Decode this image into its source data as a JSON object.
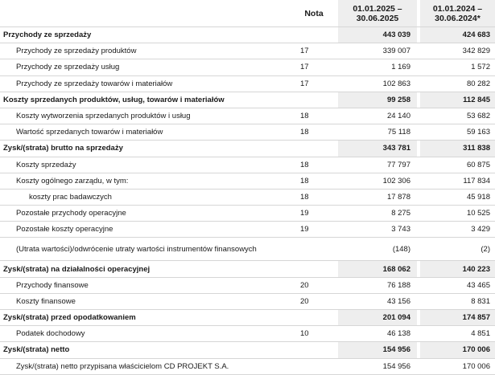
{
  "header": {
    "nota": "Nota",
    "period1_line1": "01.01.2025 –",
    "period1_line2": "30.06.2025",
    "period2_line1": "01.01.2024 –",
    "period2_line2": "30.06.2024*"
  },
  "rows": [
    {
      "label": "Przychody ze sprzedaży",
      "nota": "",
      "v1": "443 039",
      "v2": "424 683",
      "type": "total"
    },
    {
      "label": "Przychody ze sprzedaży produktów",
      "nota": "17",
      "v1": "339 007",
      "v2": "342 829",
      "type": "item"
    },
    {
      "label": "Przychody ze sprzedaży usług",
      "nota": "17",
      "v1": "1 169",
      "v2": "1 572",
      "type": "item"
    },
    {
      "label": "Przychody ze sprzedaży towarów i materiałów",
      "nota": "17",
      "v1": "102 863",
      "v2": "80 282",
      "type": "item"
    },
    {
      "label": "Koszty sprzedanych produktów, usług, towarów i materiałów",
      "nota": "",
      "v1": "99 258",
      "v2": "112 845",
      "type": "total"
    },
    {
      "label": "Koszty wytworzenia sprzedanych produktów i usług",
      "nota": "18",
      "v1": "24 140",
      "v2": "53 682",
      "type": "item"
    },
    {
      "label": "Wartość sprzedanych towarów i materiałów",
      "nota": "18",
      "v1": "75 118",
      "v2": "59 163",
      "type": "item"
    },
    {
      "label": "Zysk/(strata) brutto na sprzedaży",
      "nota": "",
      "v1": "343 781",
      "v2": "311 838",
      "type": "total"
    },
    {
      "label": "Koszty sprzedaży",
      "nota": "18",
      "v1": "77 797",
      "v2": "60 875",
      "type": "item"
    },
    {
      "label": "Koszty ogólnego zarządu, w tym:",
      "nota": "18",
      "v1": "102 306",
      "v2": "117 834",
      "type": "item"
    },
    {
      "label": "koszty prac badawczych",
      "nota": "18",
      "v1": "17 878",
      "v2": "45 918",
      "type": "subitem"
    },
    {
      "label": "Pozostałe przychody operacyjne",
      "nota": "19",
      "v1": "8 275",
      "v2": "10 525",
      "type": "item"
    },
    {
      "label": "Pozostałe koszty operacyjne",
      "nota": "19",
      "v1": "3 743",
      "v2": "3 429",
      "type": "item"
    },
    {
      "label": "(Utrata wartości)/odwrócenie utraty wartości instrumentów finansowych",
      "nota": "",
      "v1": "(148)",
      "v2": "(2)",
      "type": "item-tall"
    },
    {
      "label": "Zysk/(strata) na działalności operacyjnej",
      "nota": "",
      "v1": "168 062",
      "v2": "140 223",
      "type": "total"
    },
    {
      "label": "Przychody finansowe",
      "nota": "20",
      "v1": "76 188",
      "v2": "43 465",
      "type": "item"
    },
    {
      "label": "Koszty finansowe",
      "nota": "20",
      "v1": "43 156",
      "v2": "8 831",
      "type": "item"
    },
    {
      "label": "Zysk/(strata) przed opodatkowaniem",
      "nota": "",
      "v1": "201 094",
      "v2": "174 857",
      "type": "total"
    },
    {
      "label": "Podatek dochodowy",
      "nota": "10",
      "v1": "46 138",
      "v2": "4 851",
      "type": "item"
    },
    {
      "label": "Zysk/(strata) netto",
      "nota": "",
      "v1": "154 956",
      "v2": "170 006",
      "type": "total"
    },
    {
      "label": "Zysk/(strata) netto przypisana właścicielom CD PROJEKT S.A.",
      "nota": "",
      "v1": "154 956",
      "v2": "170 006",
      "type": "item"
    }
  ]
}
